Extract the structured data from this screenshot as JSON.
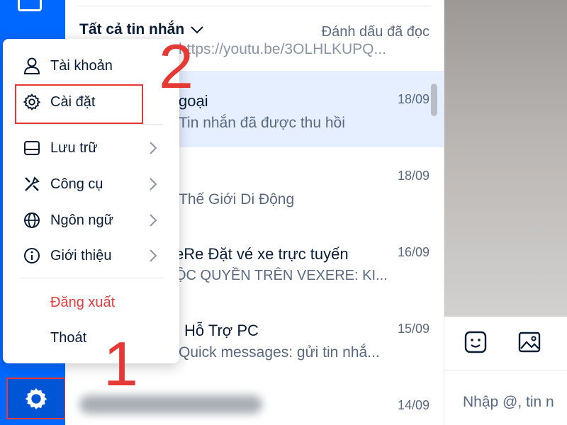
{
  "list_header": {
    "filter_label": "Tất cả tin nhắn",
    "mark_read_label": "Đánh dấu đã đọc"
  },
  "top_partial_preview": "https://youtu.be/3OLHLKUPQ...",
  "conversations": [
    {
      "name": "goại",
      "preview": "Tin nhắn đã được thu hồi",
      "time": "18/09",
      "active": true
    },
    {
      "name": "",
      "preview": "Thế Giới Di Động",
      "time": "18/09",
      "active": false
    },
    {
      "name": "eRe Đặt vé xe trực tuyến",
      "preview": "ỘC QUYỀN TRÊN VEXERE: KI...",
      "time": "16/09",
      "active": false
    },
    {
      "name": "Hỗ Trợ PC",
      "preview": "Quick messages: gửi tin nhắ...",
      "time": "15/09",
      "active": false
    },
    {
      "name": "",
      "preview": "",
      "time": "14/09",
      "active": false
    }
  ],
  "menu": {
    "items": [
      {
        "label": "Tài khoản",
        "icon": "user-icon"
      },
      {
        "label": "Cài đặt",
        "icon": "gear-icon"
      },
      {
        "label": "Lưu trữ",
        "icon": "storage-icon"
      },
      {
        "label": "Công cụ",
        "icon": "tools-icon"
      },
      {
        "label": "Ngôn ngữ",
        "icon": "globe-icon"
      },
      {
        "label": "Giới thiệu",
        "icon": "info-icon"
      }
    ],
    "logout_label": "Đăng xuất",
    "quit_label": "Thoát"
  },
  "chat": {
    "input_placeholder": "Nhập @, tin n"
  },
  "callouts": {
    "first": "1",
    "second": "2"
  },
  "colors": {
    "brand_blue": "#0068ff",
    "highlight_red": "#e53935",
    "logout_red": "#e43c3c",
    "active_row": "#e5efff"
  }
}
